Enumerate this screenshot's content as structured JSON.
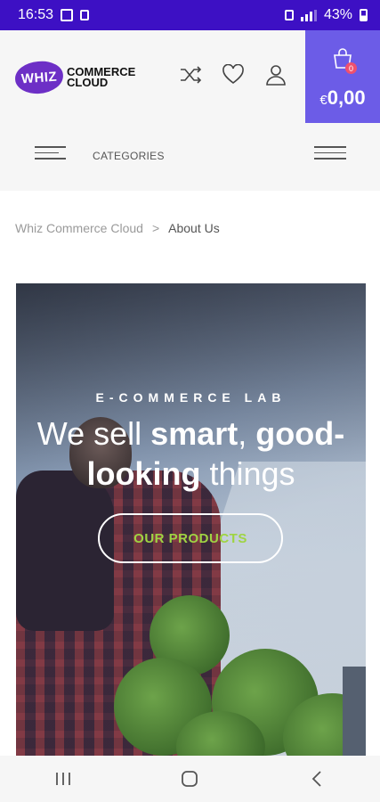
{
  "status_bar": {
    "time": "16:53",
    "battery": "43%"
  },
  "header": {
    "logo_mark": "WHIZ",
    "logo_line1": "COMMERCE",
    "logo_line2": "CLOUD",
    "cart_count": "0",
    "cart_currency": "€",
    "cart_total": "0,00"
  },
  "nav": {
    "categories_label": "CATEGORIES"
  },
  "breadcrumb": {
    "home": "Whiz Commerce Cloud",
    "separator": ">",
    "current": "About Us"
  },
  "hero": {
    "eyebrow": "E-COMMERCE LAB",
    "title_part1": "We sell ",
    "title_bold1": "smart",
    "title_part2": ", ",
    "title_bold2": "good-looking",
    "title_part3": " things",
    "button_label": "OUR PRODUCTS"
  },
  "colors": {
    "status_bar": "#3d10c4",
    "cart_bg": "#6c5ce7",
    "button_text": "#9fd443",
    "brand": "#6d2fc6"
  }
}
